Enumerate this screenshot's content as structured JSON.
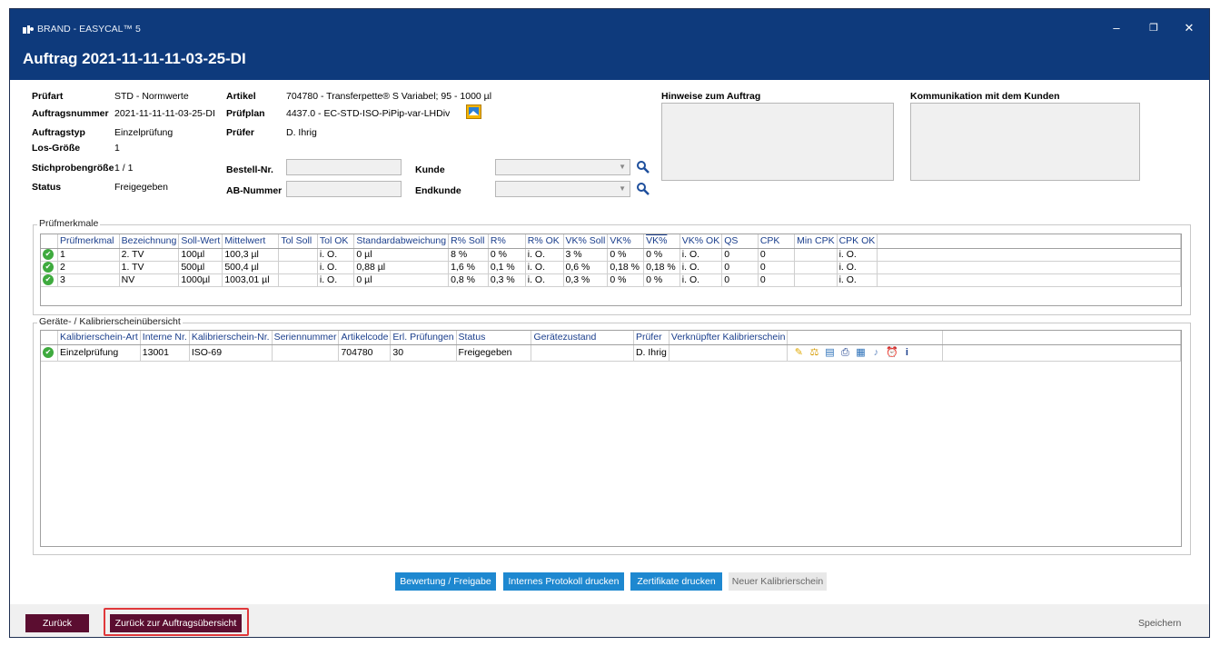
{
  "window": {
    "app_title": "BRAND - EASYCAL™ 5",
    "heading": "Auftrag 2021-11-11-11-03-25-DI"
  },
  "info": {
    "pruefart_label": "Prüfart",
    "pruefart_value": "STD - Normwerte",
    "auftragsnummer_label": "Auftragsnummer",
    "auftragsnummer_value": "2021-11-11-11-03-25-DI",
    "auftragstyp_label": "Auftragstyp",
    "auftragstyp_value": "Einzelprüfung",
    "losgroesse_label": "Los-Größe",
    "losgroesse_value": "1",
    "stichprobe_label": "Stichprobengröße",
    "stichprobe_value": "1 / 1",
    "status_label": "Status",
    "status_value": "Freigegeben",
    "artikel_label": "Artikel",
    "artikel_value": "704780 - Transferpette® S Variabel; 95 - 1000 µl",
    "pruefplan_label": "Prüfplan",
    "pruefplan_value": "4437.0 - EC-STD-ISO-PiPip-var-LHDiv",
    "pruefer_label": "Prüfer",
    "pruefer_value": "D. Ihrig",
    "bestell_label": "Bestell-Nr.",
    "ab_label": "AB-Nummer",
    "kunde_label": "Kunde",
    "endkunde_label": "Endkunde",
    "hinweise_label": "Hinweise zum Auftrag",
    "kommunikation_label": "Kommunikation mit dem Kunden"
  },
  "pruefmerkmale": {
    "title": "Prüfmerkmale",
    "columns": [
      "Prüfmerkmal",
      "Bezeichnung",
      "Soll-Wert",
      "Mittelwert",
      "Tol Soll",
      "Tol OK",
      "Standardabweichung",
      "R% Soll",
      "R%",
      "R% OK",
      "VK% Soll",
      "VK%",
      "VK%",
      "VK% OK",
      "QS",
      "CPK",
      "Min CPK",
      "CPK OK"
    ],
    "rows": [
      [
        "1",
        "2. TV",
        "100µl",
        "100,3 µl",
        "",
        "i. O.",
        "0 µl",
        "8 %",
        "0 %",
        "i. O.",
        "3 %",
        "0 %",
        "0 %",
        "i. O.",
        "0",
        "0",
        "",
        "i. O."
      ],
      [
        "2",
        "1. TV",
        "500µl",
        "500,4 µl",
        "",
        "i. O.",
        "0,88 µl",
        "1,6 %",
        "0,1 %",
        "i. O.",
        "0,6 %",
        "0,18 %",
        "0,18 %",
        "i. O.",
        "0",
        "0",
        "",
        "i. O."
      ],
      [
        "3",
        "NV",
        "1000µl",
        "1003,01 µl",
        "",
        "i. O.",
        "0 µl",
        "0,8 %",
        "0,3 %",
        "i. O.",
        "0,3 %",
        "0 %",
        "0 %",
        "i. O.",
        "0",
        "0",
        "",
        "i. O."
      ]
    ]
  },
  "geraete": {
    "title": "Geräte- / Kalibrierscheinübersicht",
    "columns": [
      "Kalibrierschein-Art",
      "Interne Nr.",
      "Kalibrierschein-Nr.",
      "Seriennummer",
      "Artikelcode",
      "Erl. Prüfungen",
      "Status",
      "Gerätezustand",
      "Prüfer",
      "Verknüpfter Kalibrierschein"
    ],
    "rows": [
      [
        "Einzelprüfung",
        "13001",
        "ISO-69",
        "",
        "704780",
        "30",
        "Freigegeben",
        "",
        "D. Ihrig",
        ""
      ]
    ]
  },
  "actions": {
    "bewertung": "Bewertung / Freigabe",
    "protokoll": "Internes Protokoll drucken",
    "zertifikate": "Zertifikate drucken",
    "neuer": "Neuer Kalibrierschein"
  },
  "footer": {
    "zurueck": "Zurück",
    "zurueck_uebersicht": "Zurück zur Auftragsübersicht",
    "speichern": "Speichern"
  },
  "colors": {
    "titlebar": "#0e3a7c",
    "action_blue": "#1e88d0",
    "maroon": "#5b0d30",
    "highlight_red": "#e0383b",
    "ok_green": "#3eaa3e"
  }
}
